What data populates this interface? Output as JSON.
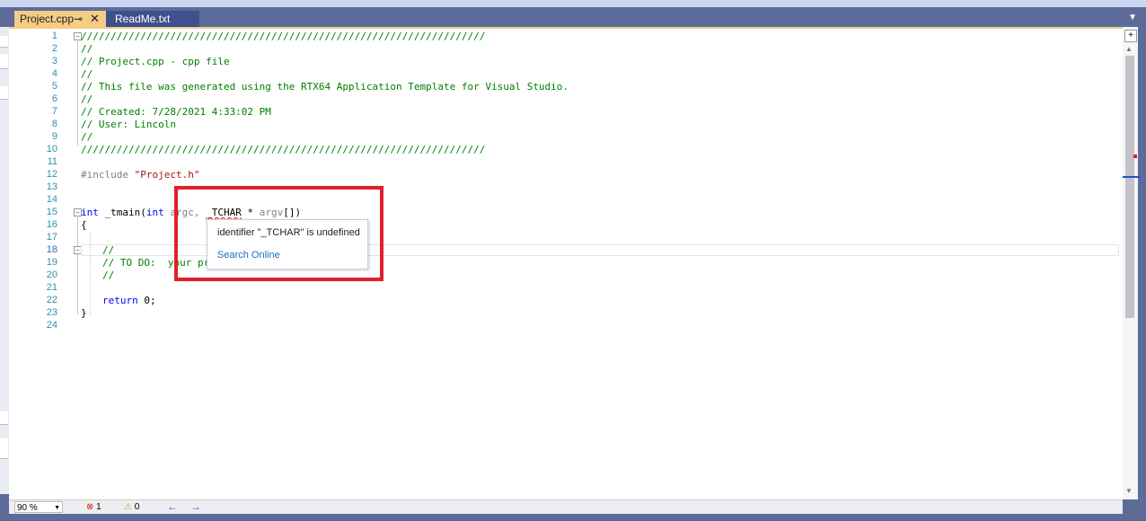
{
  "tabs": [
    {
      "label": "Project.cpp",
      "pin": "⊸",
      "close": "✕"
    },
    {
      "label": "ReadMe.txt"
    }
  ],
  "tab_dropdown": "▼",
  "line_numbers": [
    "1",
    "2",
    "3",
    "4",
    "5",
    "6",
    "7",
    "8",
    "9",
    "10",
    "11",
    "12",
    "13",
    "14",
    "15",
    "16",
    "17",
    "18",
    "19",
    "20",
    "21",
    "22",
    "23",
    "24"
  ],
  "code": {
    "l1": "////////////////////////////////////////////////////////////////////",
    "l2": "//",
    "l3": "// Project.cpp - cpp file",
    "l4": "//",
    "l5": "// This file was generated using the RTX64 Application Template for Visual Studio.",
    "l6": "//",
    "l7": "// Created: 7/28/2021 4:33:02 PM",
    "l8": "// User: Lincoln",
    "l9": "//",
    "l10": "////////////////////////////////////////////////////////////////////",
    "l12_directive": "#include",
    "l12_file": "\"Project.h\"",
    "l15": {
      "kw1": "int",
      "fn": " _tmain(",
      "kw2": "int",
      "p1": " argc, ",
      "type": "_TCHAR",
      "p2": " * ",
      "arg": "argv",
      "p3": "[])"
    },
    "l16": "{",
    "l18": "//",
    "l19": "// TO DO:  your program code here.",
    "l20": "//",
    "l22_kw": "return",
    "l22_rest": " 0;",
    "l23": "}"
  },
  "tooltip": {
    "message": "identifier \"_TCHAR\" is undefined",
    "link": "Search Online"
  },
  "status": {
    "zoom": "90 %",
    "errors": "1",
    "warnings": "0",
    "error_icon": "⊗",
    "warning_icon": "⚠",
    "back": "←",
    "forward": "→"
  },
  "colors": {
    "comment": "#008000",
    "keyword": "#0000ff",
    "string": "#a31515",
    "active_tab": "#f5cc84",
    "highlight_box": "#e0202a"
  }
}
